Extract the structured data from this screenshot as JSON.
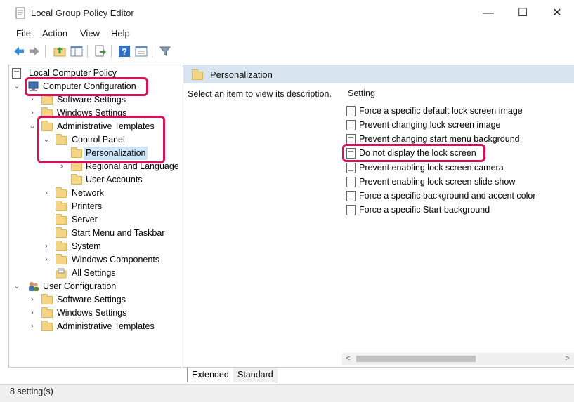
{
  "window": {
    "title": "Local Group Policy Editor",
    "controls": {
      "minimize": "—",
      "maximize": "☐",
      "close": "✕"
    }
  },
  "menu": [
    "File",
    "Action",
    "View",
    "Help"
  ],
  "toolbar": {
    "icons": [
      "back-arrow-icon",
      "forward-arrow-icon",
      "up-folder-icon",
      "show-hide-tree-icon",
      "export-list-icon",
      "help-icon",
      "properties-view-icon",
      "filter-icon"
    ]
  },
  "tree": {
    "root": "Local Computer Policy",
    "items": [
      {
        "label": "Computer Configuration",
        "level": 1,
        "expanded": true
      },
      {
        "label": "Software Settings",
        "level": 2
      },
      {
        "label": "Windows Settings",
        "level": 2
      },
      {
        "label": "Administrative Templates",
        "level": 2,
        "expanded": true
      },
      {
        "label": "Control Panel",
        "level": 3,
        "expanded": true
      },
      {
        "label": "Personalization",
        "level": 4,
        "selected": true
      },
      {
        "label": "Regional and Language",
        "level": 4
      },
      {
        "label": "User Accounts",
        "level": 4
      },
      {
        "label": "Network",
        "level": 3
      },
      {
        "label": "Printers",
        "level": 3
      },
      {
        "label": "Server",
        "level": 3
      },
      {
        "label": "Start Menu and Taskbar",
        "level": 3
      },
      {
        "label": "System",
        "level": 3
      },
      {
        "label": "Windows Components",
        "level": 3
      },
      {
        "label": "All Settings",
        "level": 3
      },
      {
        "label": "User Configuration",
        "level": 1,
        "expanded": true
      },
      {
        "label": "Software Settings",
        "level": 2
      },
      {
        "label": "Windows Settings",
        "level": 2
      },
      {
        "label": "Administrative Templates",
        "level": 2
      }
    ]
  },
  "details": {
    "header": "Personalization",
    "description_hint": "Select an item to view its description.",
    "column_header": "Setting",
    "settings": [
      "Force a specific default lock screen image",
      "Prevent changing lock screen image",
      "Prevent changing start menu background",
      "Do not display the lock screen",
      "Prevent enabling lock screen camera",
      "Prevent enabling lock screen slide show",
      "Force a specific background and accent color",
      "Force a specific Start background"
    ]
  },
  "tabs": [
    "Extended",
    "Standard"
  ],
  "status": "8 setting(s)",
  "colors": {
    "highlight_ring": "#d4145a",
    "selection": "#cce4f7",
    "folder": "#f3d585",
    "header_band": "#d8e4f0"
  },
  "highlighted_items": [
    "Computer Configuration",
    "Administrative Templates",
    "Control Panel",
    "Personalization",
    "Do not display the lock screen"
  ]
}
